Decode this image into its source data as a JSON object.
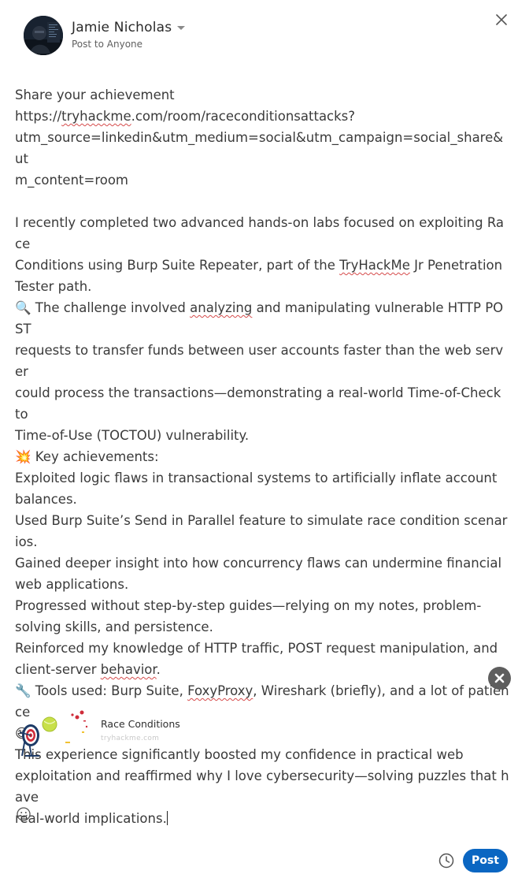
{
  "header": {
    "author_name": "Jamie Nicholas",
    "audience_label": "Post to Anyone"
  },
  "post": {
    "lines": [
      "Share your achievement",
      "https://tryhackme.com/room/raceconditionsattacks?",
      "utm_source=linkedin&utm_medium=social&utm_campaign=social_share&ut",
      "m_content=room",
      "",
      "I recently completed two advanced hands-on labs focused on exploiting Race",
      "Conditions using Burp Suite Repeater, part of the TryHackMe Jr Penetration",
      "Tester path.",
      "🔍 The challenge involved analyzing and manipulating vulnerable HTTP POST",
      "requests to transfer funds between user accounts faster than the web server",
      "could process the transactions—demonstrating a real-world Time-of-Check to",
      "Time-of-Use (TOCTOU) vulnerability.",
      "💥 Key achievements:",
      "Exploited logic flaws in transactional systems to artificially inflate account",
      "balances.",
      "Used Burp Suite’s Send in Parallel feature to simulate race condition scenarios.",
      "Gained deeper insight into how concurrency flaws can undermine financial",
      "web applications.",
      "Progressed without step-by-step guides—relying on my notes, problem-",
      "solving skills, and persistence.",
      "Reinforced my knowledge of HTTP traffic, POST request manipulation, and",
      "client-server behavior.",
      "🔧 Tools used: Burp Suite, FoxyProxy, Wireshark (briefly), and a lot of patience",
      "😄",
      "This experience significantly boosted my confidence in practical web",
      "exploitation and reaffirmed why I love cybersecurity—solving puzzles that have",
      "real-world implications."
    ],
    "misspelled": [
      "tryhackme",
      "TryHackMe",
      "analyzing",
      "FoxyProxy",
      "behavior"
    ]
  },
  "link_preview": {
    "title": "Race Conditions",
    "domain": "tryhackme.com"
  },
  "footer": {
    "post_label": "Post"
  },
  "icons": {
    "close": "close-icon",
    "caret": "caret-down-icon",
    "remove": "remove-preview-icon",
    "emoji": "emoji-smiley-icon",
    "schedule": "clock-icon"
  },
  "colors": {
    "accent": "#0a66c2",
    "remove_button": "#5e5e5e",
    "spellcheck": "#d64b4b"
  }
}
